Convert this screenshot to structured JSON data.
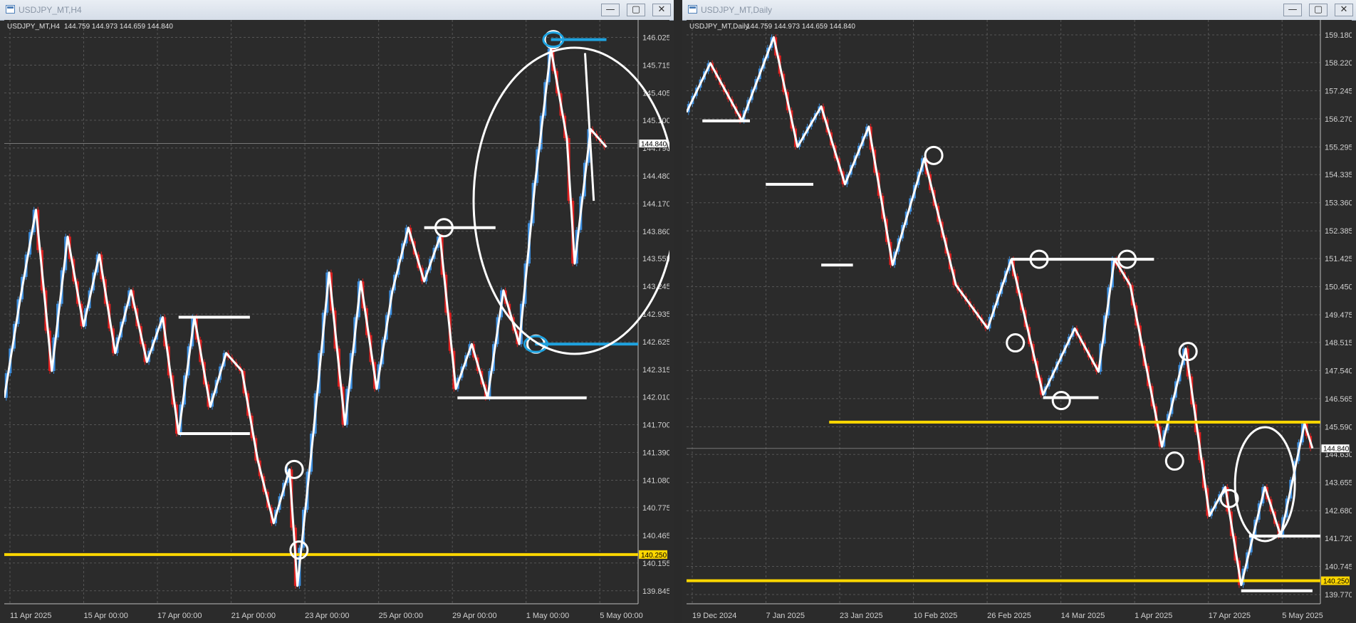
{
  "windows": [
    {
      "title": "USDJPY_MT,H4",
      "buttons": {
        "minimize": "—",
        "maximize": "▢",
        "close": "✕"
      }
    },
    {
      "title": "USDJPY_MT,Daily",
      "buttons": {
        "minimize": "—",
        "maximize": "▢",
        "close": "✕"
      }
    }
  ],
  "colors": {
    "background": "#2b2b2b",
    "grid": "#555555",
    "bull": "#3d8fe0",
    "bear": "#e02020",
    "drawing": "#ffffff",
    "support": "#ffd700",
    "highlight": "#1fa3e0"
  },
  "chart_data": [
    {
      "type": "candlestick",
      "symbol": "USDJPY_MT,H4",
      "ohlc_label": "144.759 144.973 144.659 144.840",
      "current_price": "144.840",
      "current_price_value": 144.84,
      "support_label": "140.250",
      "support_value": 140.25,
      "ylim": [
        139.7,
        146.22
      ],
      "y_ticks": [
        "146.025",
        "145.715",
        "145.405",
        "145.100",
        "144.790",
        "144.480",
        "144.170",
        "143.860",
        "143.555",
        "143.245",
        "142.935",
        "142.625",
        "142.315",
        "142.010",
        "141.700",
        "141.390",
        "141.080",
        "140.775",
        "140.465",
        "140.155",
        "139.845"
      ],
      "x_ticks": [
        "11 Apr 2025",
        "15 Apr 00:00",
        "17 Apr 00:00",
        "21 Apr 00:00",
        "23 Apr 00:00",
        "25 Apr 00:00",
        "29 Apr 00:00",
        "1 May 00:00",
        "5 May 00:00"
      ],
      "close_path": [
        [
          0,
          142.0
        ],
        [
          2,
          143.1
        ],
        [
          4,
          144.1
        ],
        [
          6,
          142.3
        ],
        [
          8,
          143.8
        ],
        [
          10,
          142.8
        ],
        [
          12,
          143.6
        ],
        [
          14,
          142.5
        ],
        [
          16,
          143.2
        ],
        [
          18,
          142.4
        ],
        [
          20,
          142.9
        ],
        [
          22,
          141.6
        ],
        [
          24,
          142.9
        ],
        [
          26,
          141.9
        ],
        [
          28,
          142.5
        ],
        [
          30,
          142.3
        ],
        [
          32,
          141.3
        ],
        [
          34,
          140.6
        ],
        [
          36,
          141.2
        ],
        [
          37,
          139.9
        ],
        [
          39,
          141.6
        ],
        [
          41,
          143.4
        ],
        [
          43,
          141.7
        ],
        [
          45,
          143.3
        ],
        [
          47,
          142.1
        ],
        [
          49,
          143.2
        ],
        [
          51,
          143.9
        ],
        [
          53,
          143.3
        ],
        [
          55,
          143.8
        ],
        [
          57,
          142.1
        ],
        [
          59,
          142.6
        ],
        [
          61,
          142.0
        ],
        [
          63,
          143.2
        ],
        [
          65,
          142.6
        ],
        [
          67,
          144.4
        ],
        [
          69,
          145.9
        ],
        [
          71,
          144.9
        ],
        [
          72,
          143.5
        ],
        [
          74,
          145.0
        ],
        [
          76,
          144.8
        ]
      ],
      "swing_circles": [
        {
          "x": 37.2,
          "y": 140.3,
          "label": "low"
        },
        {
          "x": 36.6,
          "y": 141.2,
          "label": "swing"
        },
        {
          "x": 55.5,
          "y": 143.9,
          "label": "swing"
        },
        {
          "x": 69.3,
          "y": 146.0,
          "label": "high"
        },
        {
          "x": 67.1,
          "y": 142.6,
          "label": "retest"
        }
      ]
    },
    {
      "type": "candlestick",
      "symbol": "USDJPY_MT,Daily",
      "ohlc_label": "144.759 144.973 144.659 144.840",
      "current_price": "144.840",
      "current_price_value": 144.84,
      "support_label": "140.250",
      "support_value": 140.25,
      "ylim": [
        139.45,
        159.7
      ],
      "y_ticks": [
        "159.180",
        "158.220",
        "157.245",
        "156.270",
        "155.295",
        "154.335",
        "153.360",
        "152.385",
        "151.425",
        "150.450",
        "149.475",
        "148.515",
        "147.540",
        "146.565",
        "145.590",
        "144.630",
        "143.655",
        "142.680",
        "141.720",
        "140.745",
        "139.770"
      ],
      "x_ticks": [
        "19 Dec 2024",
        "7 Jan 2025",
        "23 Jan 2025",
        "10 Feb 2025",
        "26 Feb 2025",
        "14 Mar 2025",
        "1 Apr 2025",
        "17 Apr 2025",
        "5 May 2025"
      ],
      "close_path": [
        [
          0,
          156.5
        ],
        [
          3,
          158.2
        ],
        [
          7,
          156.2
        ],
        [
          11,
          159.1
        ],
        [
          14,
          155.3
        ],
        [
          17,
          156.7
        ],
        [
          20,
          154.0
        ],
        [
          23,
          156.0
        ],
        [
          26,
          151.2
        ],
        [
          30,
          154.9
        ],
        [
          34,
          150.5
        ],
        [
          38,
          149.0
        ],
        [
          41,
          151.4
        ],
        [
          45,
          146.7
        ],
        [
          49,
          149.0
        ],
        [
          52,
          147.5
        ],
        [
          54,
          151.4
        ],
        [
          56,
          150.5
        ],
        [
          60,
          144.9
        ],
        [
          63,
          148.3
        ],
        [
          66,
          142.5
        ],
        [
          68,
          143.5
        ],
        [
          70,
          140.1
        ],
        [
          73,
          143.5
        ],
        [
          75,
          141.8
        ],
        [
          78,
          145.7
        ],
        [
          79,
          144.84
        ]
      ],
      "swing_circles": [
        {
          "x": 31.2,
          "y": 155.0,
          "label": "high"
        },
        {
          "x": 41.5,
          "y": 148.5,
          "label": "low"
        },
        {
          "x": 44.5,
          "y": 151.4,
          "label": "high"
        },
        {
          "x": 47.3,
          "y": 146.5,
          "label": "low"
        },
        {
          "x": 55.6,
          "y": 151.4,
          "label": "high"
        },
        {
          "x": 63.3,
          "y": 148.2,
          "label": "high"
        },
        {
          "x": 61.6,
          "y": 144.4,
          "label": "low"
        },
        {
          "x": 68.5,
          "y": 143.1,
          "label": "swing"
        }
      ]
    }
  ]
}
